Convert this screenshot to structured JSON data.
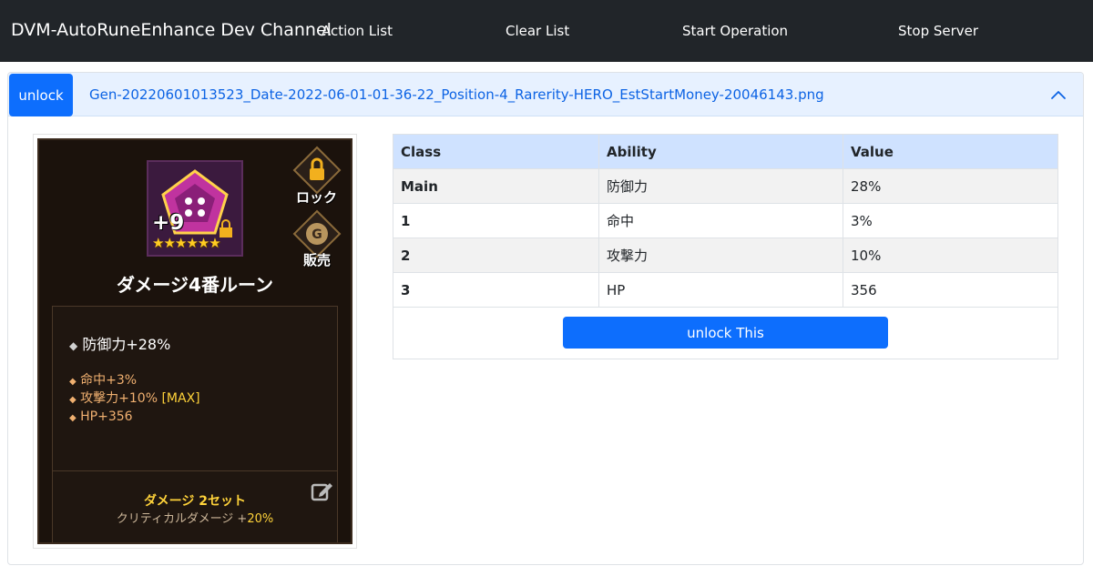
{
  "navbar": {
    "brand": "DVM-AutoRuneEnhance Dev Channel",
    "links": [
      "Action List",
      "Clear List",
      "Start Operation",
      "Stop Server"
    ]
  },
  "card": {
    "unlock_label": "unlock",
    "filename": "Gen-20220601013523_Date-2022-06-01-01-36-22_Position-4_Rarerity-HERO_EstStartMoney-20046143.png",
    "chevron_icon": "chevron-up-icon"
  },
  "screenshot": {
    "rune_level": "+9",
    "stars": "★★★★★★",
    "lock_label": "ロック",
    "sell_label": "販売",
    "rune_name": "ダメージ4番ルーン",
    "main_stat": "防御力+28%",
    "sub_stats": [
      "命中+3%",
      "攻撃力+10%",
      "HP+356"
    ],
    "max_tag": "[MAX]",
    "set_name": "ダメージ 2セット",
    "set_effect": "クリティカルダメージ +",
    "set_bonus": "20%"
  },
  "table": {
    "headers": [
      "Class",
      "Ability",
      "Value"
    ],
    "rows": [
      {
        "cls": "Main",
        "ability": "防御力",
        "value": "28%"
      },
      {
        "cls": "1",
        "ability": "命中",
        "value": "3%"
      },
      {
        "cls": "2",
        "ability": "攻撃力",
        "value": "10%"
      },
      {
        "cls": "3",
        "ability": "HP",
        "value": "356"
      }
    ],
    "button_label": "unlock This"
  },
  "colors": {
    "navbar_bg": "#212529",
    "primary": "#0d6efd",
    "header_bg": "#e7f1ff",
    "table_header_bg": "#cfe2ff"
  }
}
